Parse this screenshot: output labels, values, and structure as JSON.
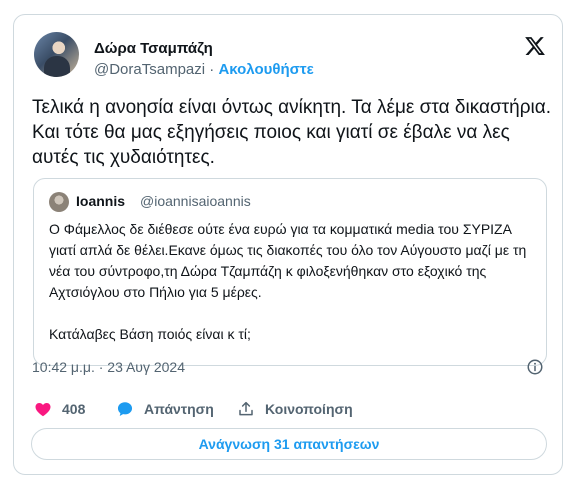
{
  "author": {
    "name": "Δώρα Τσαμπάζη",
    "handle": "@DoraTsampazi",
    "separator": "·",
    "follow_label": "Ακολουθήστε"
  },
  "tweet": {
    "text": "Τελικά η ανοησία είναι όντως ανίκητη. Τα λέμε στα δικαστήρια. Και τότε θα μας εξηγήσεις ποιος και γιατί σε έβαλε να λες αυτές τις χυδαιότητες."
  },
  "quote": {
    "name": "Ioannis",
    "handle": "@ioannisaioannis",
    "paragraph1": "Ο Φάμελλος δε διέθεσε ούτε ένα ευρώ για τα κομματικά media του ΣΥΡΙΖΑ γιατί απλά δε θέλει.Εκανε όμως τις διακοπές του όλο τον Αύγουστο μαζί με τη νέα του σύντροφο,τη Δώρα Τζαμπάζη κ φιλοξενήθηκαν στο εξοχικό της Αχτσιόγλου στο Πήλιο για 5 μέρες.",
    "paragraph2": "Κατάλαβες Βάση ποιός είναι κ τί;"
  },
  "meta": {
    "timestamp": "10:42 μ.μ. · 23 Αυγ 2024"
  },
  "actions": {
    "likes": "408",
    "reply_label": "Απάντηση",
    "share_label": "Κοινοποίηση"
  },
  "read_replies_label": "Ανάγνωση 31 απαντήσεων",
  "colors": {
    "accent": "#1d9bf0",
    "like": "#f91880",
    "secondary_text": "#536471",
    "border": "#cfd9de"
  },
  "icons": [
    "x-logo-icon",
    "info-icon",
    "heart-icon",
    "reply-bubble-icon",
    "share-icon"
  ]
}
